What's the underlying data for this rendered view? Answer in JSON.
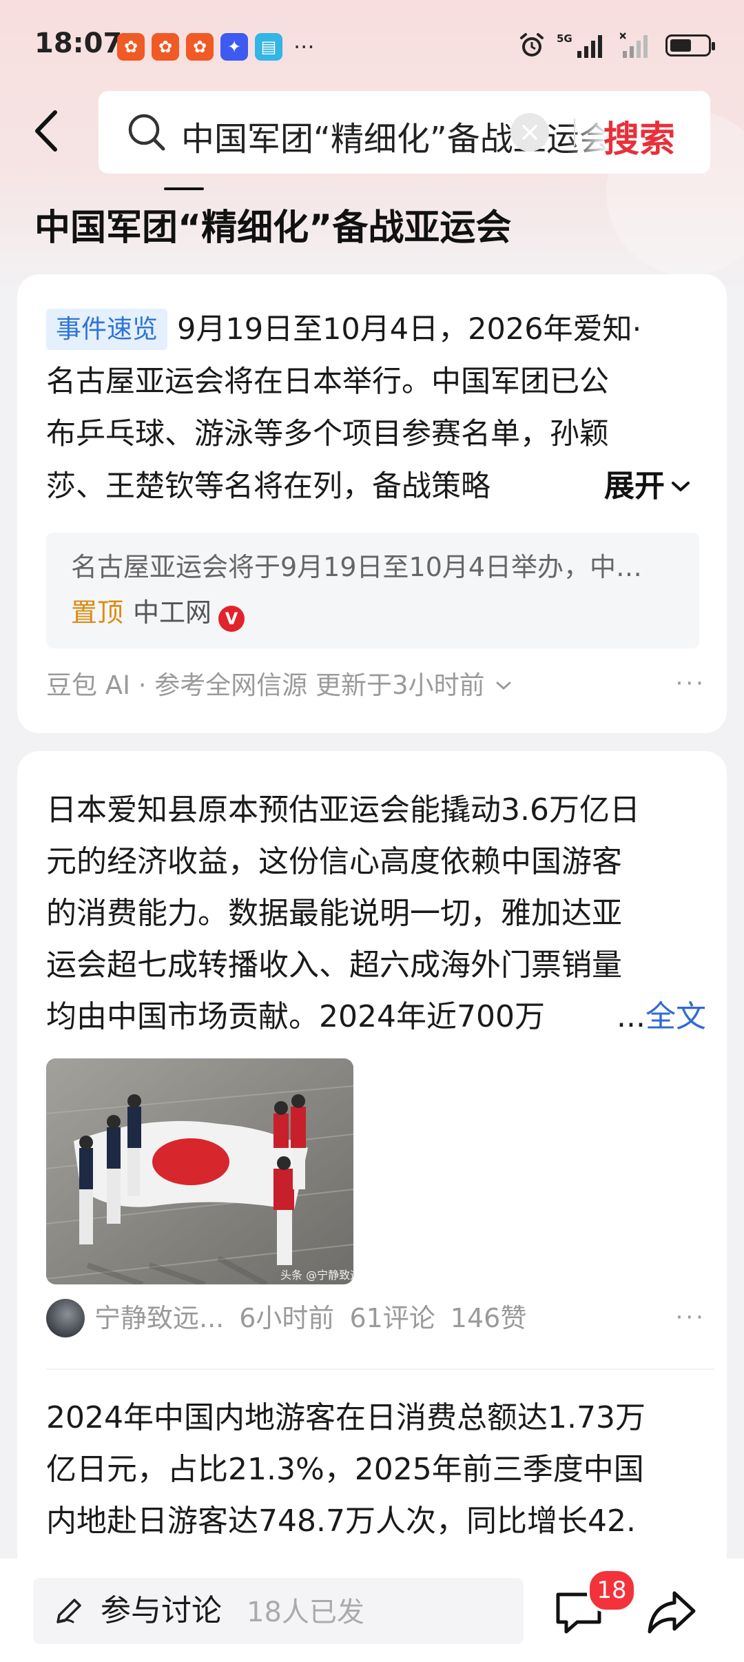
{
  "status_bar": {
    "time": "18:07",
    "app_icons": [
      {
        "name": "app-icon-1",
        "color": "#f05a24"
      },
      {
        "name": "app-icon-2",
        "color": "#f05a24"
      },
      {
        "name": "app-icon-3",
        "color": "#f05a24"
      },
      {
        "name": "app-icon-4",
        "color": "#3d5af1"
      },
      {
        "name": "app-icon-5",
        "color": "#33b5e5"
      }
    ],
    "more": "···",
    "network_label": "5G"
  },
  "search": {
    "query": "中国军团“精细化”备战亚运会",
    "button_label": "搜索"
  },
  "page_title": "中国军团“精细化”备战亚运会",
  "summary_card": {
    "tag": "事件速览",
    "line1": "9月19日至10月4日，2026年爱知·",
    "line2": "名古屋亚运会将在日本举行。中国军团已公",
    "line3": "布乒乓球、游泳等多个项目参赛名单，孙颖",
    "line4": "莎、王楚钦等名将在列，备战策略",
    "expand_label": "展开",
    "source_text": "名古屋亚运会将于9月19日至10月4日举办，中…",
    "source_pin": "置顶",
    "source_name": "中工网",
    "verified_mark": "V",
    "ai_line": "豆包 AI · 参考全网信源 更新于3小时前",
    "more": "···"
  },
  "post": {
    "line1": "日本爱知县原本预估亚运会能撬动3.6万亿日",
    "line2": "元的经济收益，这份信心高度依赖中国游客",
    "line3": "的消费能力。数据最能说明一切，雅加达亚",
    "line4": "运会超七成转播收入、超六成海外门票销量",
    "line5": "均由中国市场贡献。2024年近700万",
    "ellipsis": "...",
    "fulltext_label": "全文",
    "image_caption": "头条 @宁静致远",
    "author": "宁静致远...",
    "time": "6小时前",
    "comments": "61评论",
    "likes": "146赞",
    "more": "···"
  },
  "post2": {
    "line1": "2024年中国内地游客在日消费总额达1.73万",
    "line2": "亿日元，占比21.3%，2025年前三季度中国",
    "line3": "内地赴日游客达748.7万人次，同比增长42."
  },
  "bottom_bar": {
    "discuss_label": "参与讨论",
    "discuss_count": "18人已发",
    "comment_badge": "18"
  },
  "colors": {
    "accent_red": "#e8303a",
    "link_blue": "#2f6bd6",
    "tag_blue": "#2f74d6",
    "pin_orange": "#dc8b11"
  }
}
